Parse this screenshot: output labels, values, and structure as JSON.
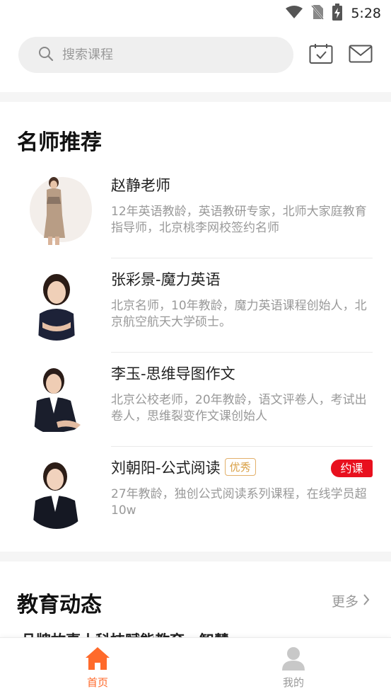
{
  "status_bar": {
    "time": "5:28"
  },
  "search": {
    "placeholder": "搜索课程"
  },
  "teachers_section": {
    "title": "名师推荐",
    "items": [
      {
        "name": "赵静老师",
        "desc": "12年英语教龄，英语教研专家，北师大家庭教育指导师，北京桃李网校签约名师"
      },
      {
        "name": "张彩景-魔力英语",
        "desc": "北京名师，10年教龄，魔力英语课程创始人，北京航空航天大学硕士。"
      },
      {
        "name": "李玉-思维导图作文",
        "desc": "北京公校老师，20年教龄，语文评卷人，考试出卷人，思维裂变作文课创始人"
      },
      {
        "name": "刘朝阳-公式阅读",
        "badge": "优秀",
        "book_label": "约课",
        "desc": "27年教龄，独创公式阅读系列课程，在线学员超10w"
      }
    ]
  },
  "news_section": {
    "title": "教育动态",
    "more_label": "更多",
    "first_item_title": "品牌故事丨科技赋能教育，智慧"
  },
  "nav": {
    "home_label": "首页",
    "mine_label": "我的"
  },
  "colors": {
    "accent": "#ff6a2b",
    "badge_red": "#e8101e",
    "badge_gold": "#d9a046"
  },
  "icons": [
    "search-icon",
    "calendar-check-icon",
    "mail-icon",
    "wifi-icon",
    "no-sim-icon",
    "battery-charging-icon",
    "home-icon",
    "user-icon",
    "chevron-right-icon"
  ]
}
